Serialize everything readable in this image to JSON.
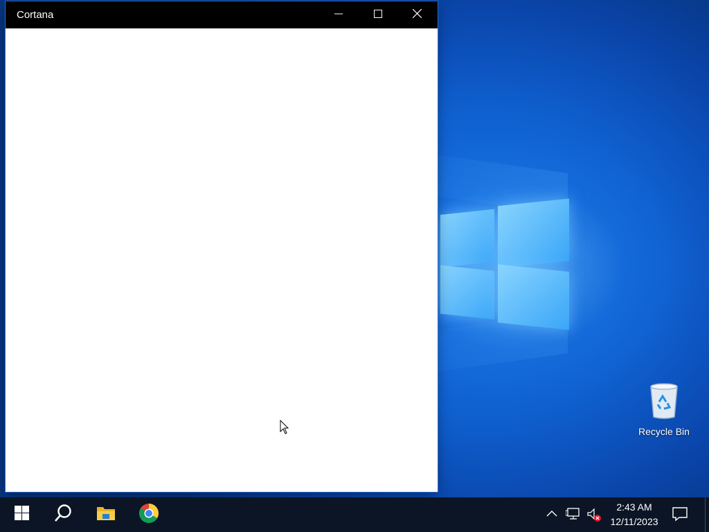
{
  "window": {
    "title": "Cortana",
    "controls": {
      "minimize_icon": "minimize-icon",
      "maximize_icon": "maximize-icon",
      "close_icon": "close-icon"
    }
  },
  "desktop": {
    "icons": [
      {
        "label": "Recycle Bin",
        "icon": "recycle-bin-icon"
      }
    ],
    "wallpaper_colors": [
      "#0a44a8",
      "#1a78e6",
      "#8cd7ff"
    ]
  },
  "taskbar": {
    "items": [
      {
        "name": "start",
        "icon": "windows-logo-icon"
      },
      {
        "name": "search",
        "icon": "search-icon"
      },
      {
        "name": "file-explorer",
        "icon": "folder-icon"
      },
      {
        "name": "chrome",
        "icon": "chrome-icon"
      }
    ],
    "tray": {
      "chevron_icon": "chevron-up-icon",
      "network_icon": "network-icon",
      "volume_icon": "volume-muted-icon"
    },
    "clock": {
      "time": "2:43 AM",
      "date": "12/11/2023"
    },
    "notification_icon": "notification-icon",
    "background": "#0b1525"
  }
}
